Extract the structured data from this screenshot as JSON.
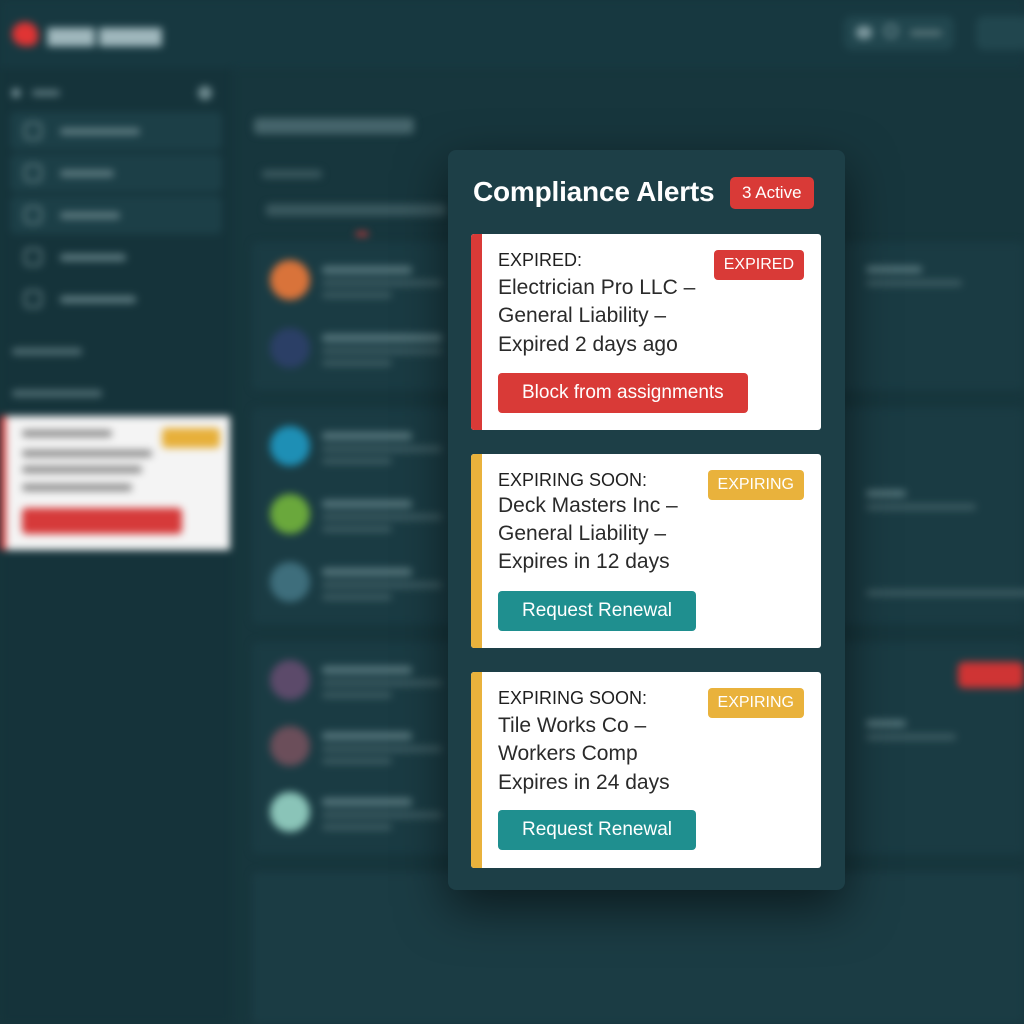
{
  "colors": {
    "expired": "#d93a37",
    "expiring": "#e9b23c",
    "teal_button": "#1f8f8f",
    "modal_bg": "#1d3f47",
    "page_bg": "#17363d"
  },
  "modal": {
    "title": "Compliance Alerts",
    "badge": "3 Active",
    "alerts": [
      {
        "status": "EXPIRED:",
        "vendor": "Electrician Pro LLC –",
        "coverage": "General Liability –",
        "timing": "Expired 2 days ago",
        "tag": "EXPIRED",
        "action": "Block from assignments",
        "severity": "expired"
      },
      {
        "status": "EXPIRING SOON:",
        "vendor": "Deck Masters Inc –",
        "coverage": "General Liability –",
        "timing": "Expires in 12 days",
        "tag": "EXPIRING",
        "action": "Request Renewal",
        "severity": "expiring"
      },
      {
        "status": "EXPIRING SOON:",
        "vendor": "Tile Works Co –",
        "coverage": "Workers Comp",
        "timing": "Expires in 24 days",
        "tag": "EXPIRING",
        "action": "Request Renewal",
        "severity": "expiring"
      }
    ]
  },
  "background": {
    "page_title": "Compliance Alerts",
    "icons": [
      "logo-icon",
      "chat-icon",
      "search-icon",
      "settings-icon",
      "home-icon",
      "folder-icon",
      "tools-icon"
    ]
  }
}
